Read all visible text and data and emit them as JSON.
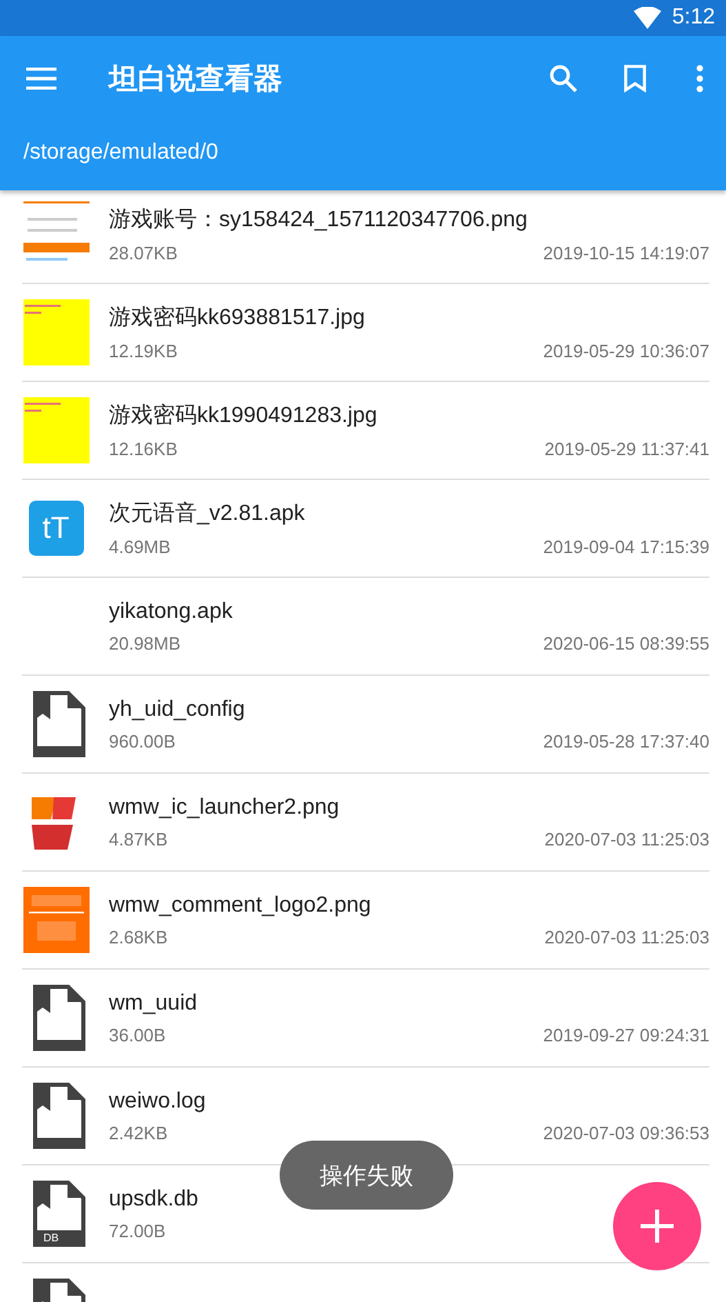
{
  "status_bar": {
    "time": "5:12"
  },
  "app_bar": {
    "title": "坦白说查看器",
    "path": "/storage/emulated/0"
  },
  "files": [
    {
      "name": "游戏账号：sy158424_1571120347706.png",
      "size": "28.07KB",
      "date": "2019-10-15 14:19:07"
    },
    {
      "name": "游戏密码kk693881517.jpg",
      "size": "12.19KB",
      "date": "2019-05-29 10:36:07"
    },
    {
      "name": "游戏密码kk1990491283.jpg",
      "size": "12.16KB",
      "date": "2019-05-29 11:37:41"
    },
    {
      "name": "次元语音_v2.81.apk",
      "size": "4.69MB",
      "date": "2019-09-04 17:15:39",
      "icon": {
        "kind": "app",
        "label": "tT"
      }
    },
    {
      "name": "yikatong.apk",
      "size": "20.98MB",
      "date": "2020-06-15 08:39:55",
      "icon": {
        "kind": "none"
      }
    },
    {
      "name": "yh_uid_config",
      "size": "960.00B",
      "date": "2019-05-28 17:37:40",
      "icon": {
        "kind": "file"
      }
    },
    {
      "name": "wmw_ic_launcher2.png",
      "size": "4.87KB",
      "date": "2020-07-03 11:25:03"
    },
    {
      "name": "wmw_comment_logo2.png",
      "size": "2.68KB",
      "date": "2020-07-03 11:25:03"
    },
    {
      "name": "wm_uuid",
      "size": "36.00B",
      "date": "2019-09-27 09:24:31",
      "icon": {
        "kind": "file"
      }
    },
    {
      "name": "weiwo.log",
      "size": "2.42KB",
      "date": "2020-07-03 09:36:53",
      "icon": {
        "kind": "file"
      }
    },
    {
      "name": "upsdk.db",
      "size": "72.00B",
      "icon": {
        "kind": "file",
        "badge": "DB"
      }
    },
    {
      "icon": {
        "kind": "file"
      }
    }
  ],
  "toast": "操作失败"
}
